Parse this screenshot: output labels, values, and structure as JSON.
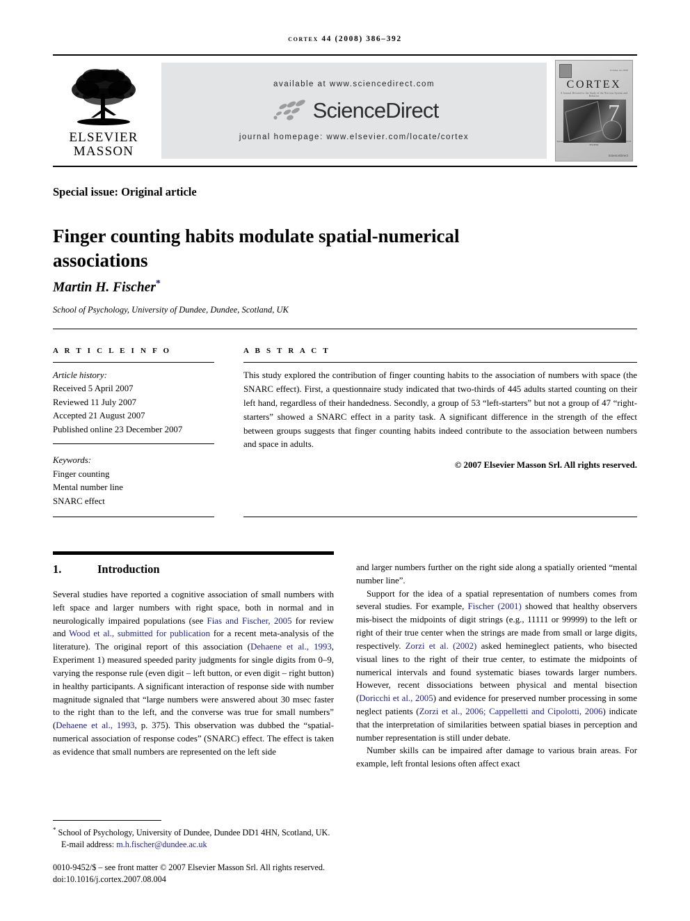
{
  "running_head": "cortex 44 (2008) 386–392",
  "masthead": {
    "publisher_name": "ELSEVIER",
    "publisher_name2": "MASSON",
    "available_at": "available at www.sciencedirect.com",
    "sciencedirect_wordmark": "ScienceDirect",
    "journal_homepage": "journal homepage: www.elsevier.com/locate/cortex",
    "cover": {
      "title": "CORTEX",
      "subtitle": "A Journal Devoted to the Study of the Nervous System and Behavior",
      "issue_note": "Volume 44 2008",
      "volume_digit": "7",
      "footer_line": "Special issue\nEDITORS: SERGIO DELLA SALA\nGUEST EDITORS: MARTIN H. FISCHER",
      "sciencedirect_mark": "ScienceDirect"
    }
  },
  "article": {
    "special_issue_label": "Special issue: Original article",
    "title": "Finger counting habits modulate spatial-numerical associations",
    "author": "Martin H. Fischer",
    "author_star": "*",
    "affiliation": "School of Psychology, University of Dundee, Dundee, Scotland, UK"
  },
  "info": {
    "heading": "A R T I C L E   I N F O",
    "history_label": "Article history:",
    "history": [
      "Received 5 April 2007",
      "Reviewed 11 July 2007",
      "Accepted 21 August 2007",
      "Published online 23 December 2007"
    ],
    "keywords_label": "Keywords:",
    "keywords": [
      "Finger counting",
      "Mental number line",
      "SNARC effect"
    ]
  },
  "abstract": {
    "heading": "A B S T R A C T",
    "text": "This study explored the contribution of finger counting habits to the association of numbers with space (the SNARC effect). First, a questionnaire study indicated that two-thirds of 445 adults started counting on their left hand, regardless of their handedness. Secondly, a group of 53 “left-starters” but not a group of 47 “right-starters” showed a SNARC effect in a parity task. A significant difference in the strength of the effect between groups suggests that finger counting habits indeed contribute to the association between numbers and space in adults.",
    "copyright": "© 2007 Elsevier Masson Srl. All rights reserved."
  },
  "introduction": {
    "number": "1.",
    "heading": "Introduction",
    "left_paragraph_1_a": "Several studies have reported a cognitive association of small numbers with left space and larger numbers with right space, both in normal and in neurologically impaired populations (see ",
    "cite_fias": "Fias and Fischer, 2005",
    "left_paragraph_1_b": " for review and ",
    "cite_wood": "Wood et al., submitted for publication",
    "left_paragraph_1_c": " for a recent meta-analysis of the literature). The original report of this association (",
    "cite_dehaene1": "Dehaene et al., 1993",
    "left_paragraph_1_d": ", Experiment 1) measured speeded parity judgments for single digits from 0–9, varying the response rule (even digit – left button, or even digit – right button) in healthy participants. A significant interaction of response side with number magnitude signaled that “large numbers were answered about 30 msec faster to the right than to the left, and the converse was true for small numbers” (",
    "cite_dehaene2": "Dehaene et al., 1993",
    "left_paragraph_1_e": ", p. 375). This observation was dubbed the “spatial-numerical association of response codes” (SNARC) effect. The effect is taken as evidence that small numbers are represented on the left side",
    "right_paragraph_1": "and larger numbers further on the right side along a spatially oriented “mental number line”.",
    "right_paragraph_2_a": "Support for the idea of a spatial representation of numbers comes from several studies. For example, ",
    "cite_fischer2001": "Fischer (2001)",
    "right_paragraph_2_b": " showed that healthy observers mis-bisect the midpoints of digit strings (e.g., 11111 or 99999) to the left or right of their true center when the strings are made from small or large digits, respectively. ",
    "cite_zorzi2002": "Zorzi et al. (2002)",
    "right_paragraph_2_c": " asked hemineglect patients, who bisected visual lines to the right of their true center, to estimate the midpoints of numerical intervals and found systematic biases towards larger numbers. However, recent dissociations between physical and mental bisection (",
    "cite_doricchi": "Doricchi et al., 2005",
    "right_paragraph_2_d": ") and evidence for preserved number processing in some neglect patients (",
    "cite_zorzi2006": "Zorzi et al., 2006; Cappelletti and Cipolotti, 2006",
    "right_paragraph_2_e": ") indicate that the interpretation of similarities between spatial biases in perception and number representation is still under debate.",
    "right_paragraph_3": "Number skills can be impaired after damage to various brain areas. For example, left frontal lesions often affect exact"
  },
  "footer": {
    "correspondence_star": "*",
    "correspondence": "School of Psychology, University of Dundee, Dundee DD1 4HN, Scotland, UK.",
    "email_label": "E-mail address: ",
    "email": "m.h.fischer@dundee.ac.uk",
    "imprint_line1": "0010-9452/$ – see front matter © 2007 Elsevier Masson Srl. All rights reserved.",
    "imprint_line2": "doi:10.1016/j.cortex.2007.08.004"
  },
  "colors": {
    "link_blue": "#1c1c8f",
    "banner_gray": "#e3e4e6"
  }
}
